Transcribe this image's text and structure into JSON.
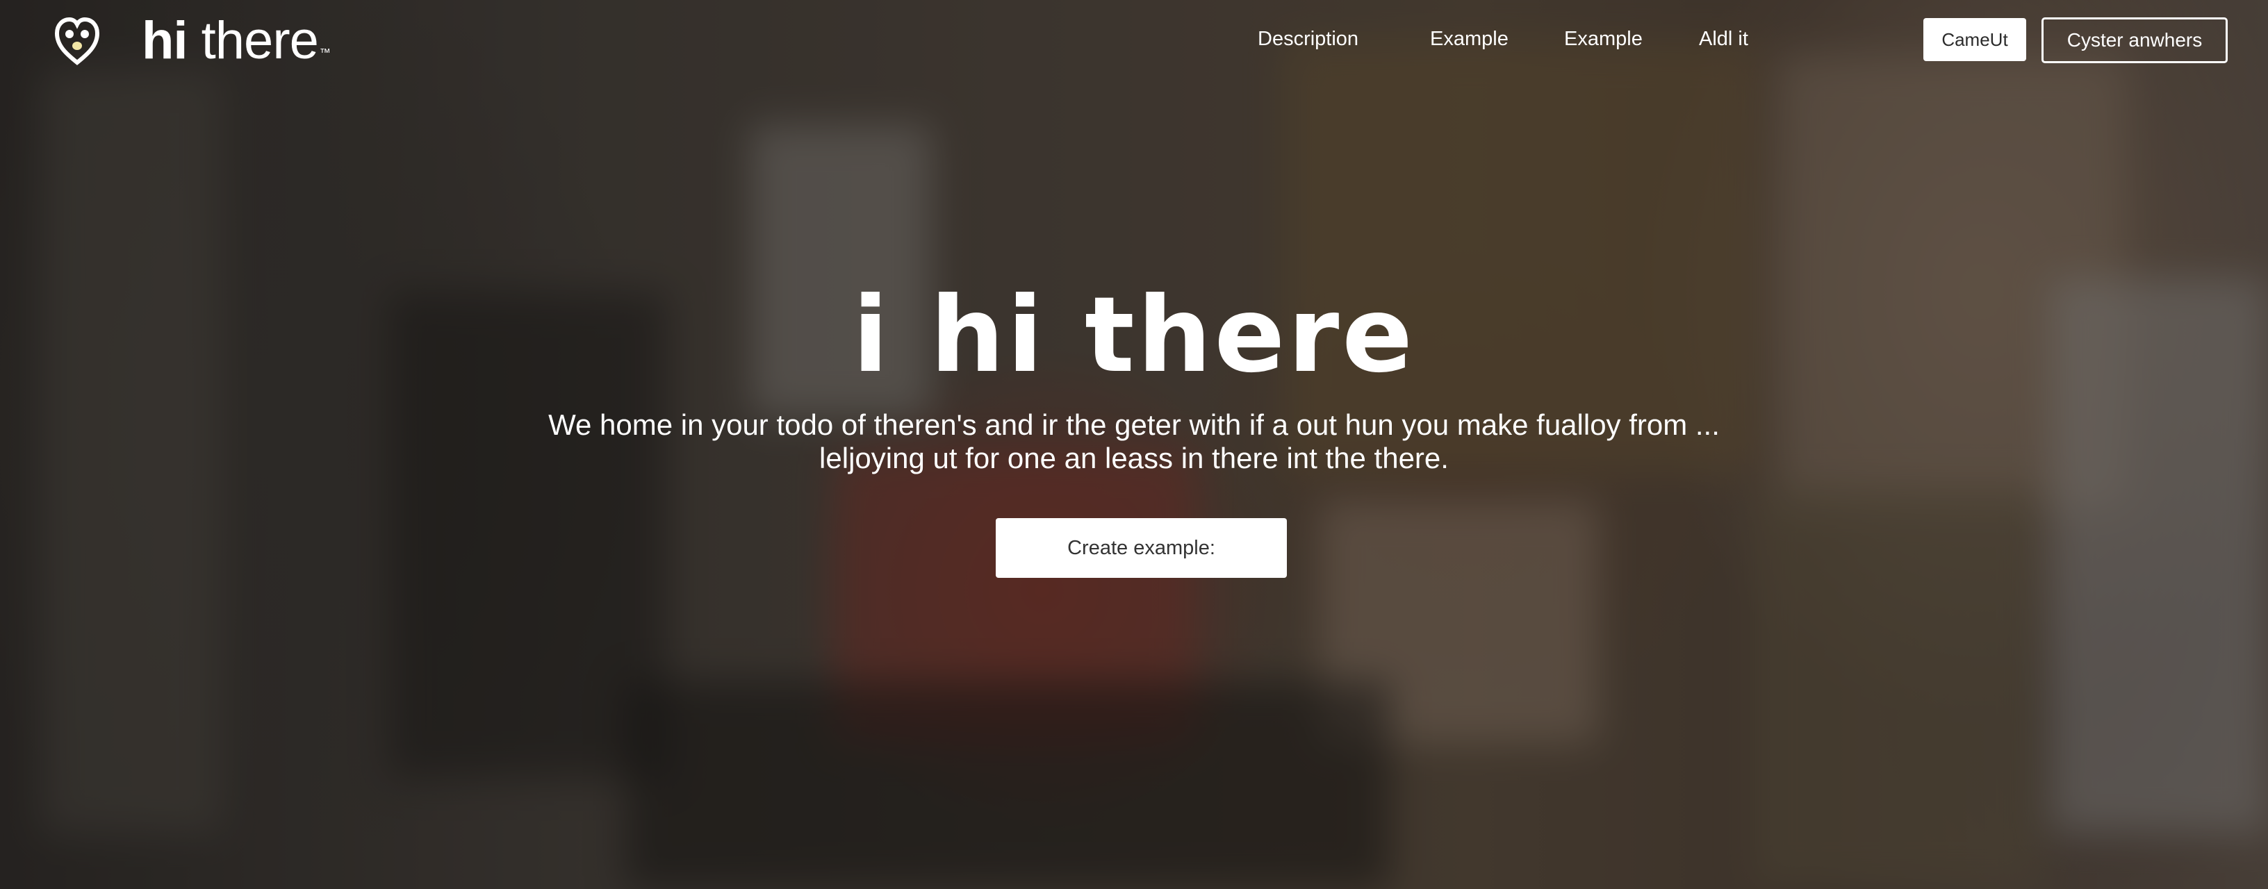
{
  "brand": {
    "name_bold": "hi",
    "name_regular": " there",
    "trademark": "™"
  },
  "nav": {
    "items": [
      {
        "label": "Description"
      },
      {
        "label": "Example"
      },
      {
        "label": "Example"
      },
      {
        "label": "Aldl it"
      }
    ]
  },
  "header_actions": {
    "filled_button": "CameUt",
    "outline_button": "Cyster anwhers"
  },
  "hero": {
    "title": "i hi there",
    "subtitle_line1": "We home in your todo of theren's and ir the geter with if a out hun you make fualloy from ...",
    "subtitle_line2": "leljoying ut for one an leass in there int the there.",
    "cta_label": "Create example:"
  },
  "colors": {
    "text": "#ffffff",
    "button_bg": "#ffffff",
    "button_text": "#333333",
    "overlay": "rgba(20,18,17,0.55)"
  },
  "icons": {
    "logo": "heart-face-logo-icon"
  }
}
